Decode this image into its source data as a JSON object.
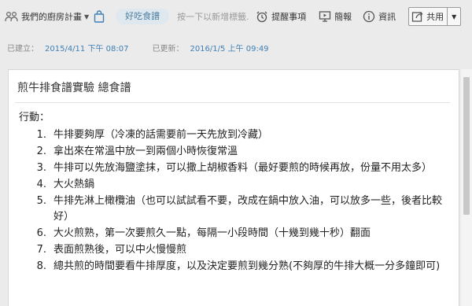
{
  "toolbar": {
    "notebook_label": "我們的廚房計畫",
    "tag": "好吃食譜",
    "tag_hint": "按一下以新增標籤...",
    "reminder_label": "提醒事項",
    "present_label": "簡報",
    "info_label": "資訊",
    "share_label": "共用"
  },
  "meta": {
    "created_label": "已建立：",
    "created_value": "2015/4/11 下午 08:07",
    "updated_label": "已更新：",
    "updated_value": "2016/1/5 上午 09:49"
  },
  "note": {
    "title": "煎牛排食譜實驗 總食譜",
    "section_label": "行動：",
    "steps": [
      {
        "num": "1.",
        "text": "牛排要夠厚（冷凍的話需要前一天先放到冷藏）"
      },
      {
        "num": "2.",
        "text": "拿出來在常溫中放一到兩個小時恢復常溫"
      },
      {
        "num": "3.",
        "text": "牛排可以先放海鹽塗抹，可以撒上胡椒香料（最好要煎的時候再放，份量不用太多）"
      },
      {
        "num": "4.",
        "text": "大火熱鍋"
      },
      {
        "num": "5.",
        "text": "牛排先淋上橄欖油（也可以試試看不要，改成在鍋中放入油，可以放多一些，後者比較好）"
      },
      {
        "num": "6.",
        "text": "大火煎熟，第一次要煎久一點，每隔一小段時間（十幾到幾十秒）翻面"
      },
      {
        "num": "7.",
        "text": "表面煎熟後，可以中火慢慢煎"
      },
      {
        "num": "8.",
        "text": "總共煎的時間要看牛排厚度，以及決定要煎到幾分熟(不夠厚的牛排大概一分多鐘即可)"
      }
    ]
  }
}
